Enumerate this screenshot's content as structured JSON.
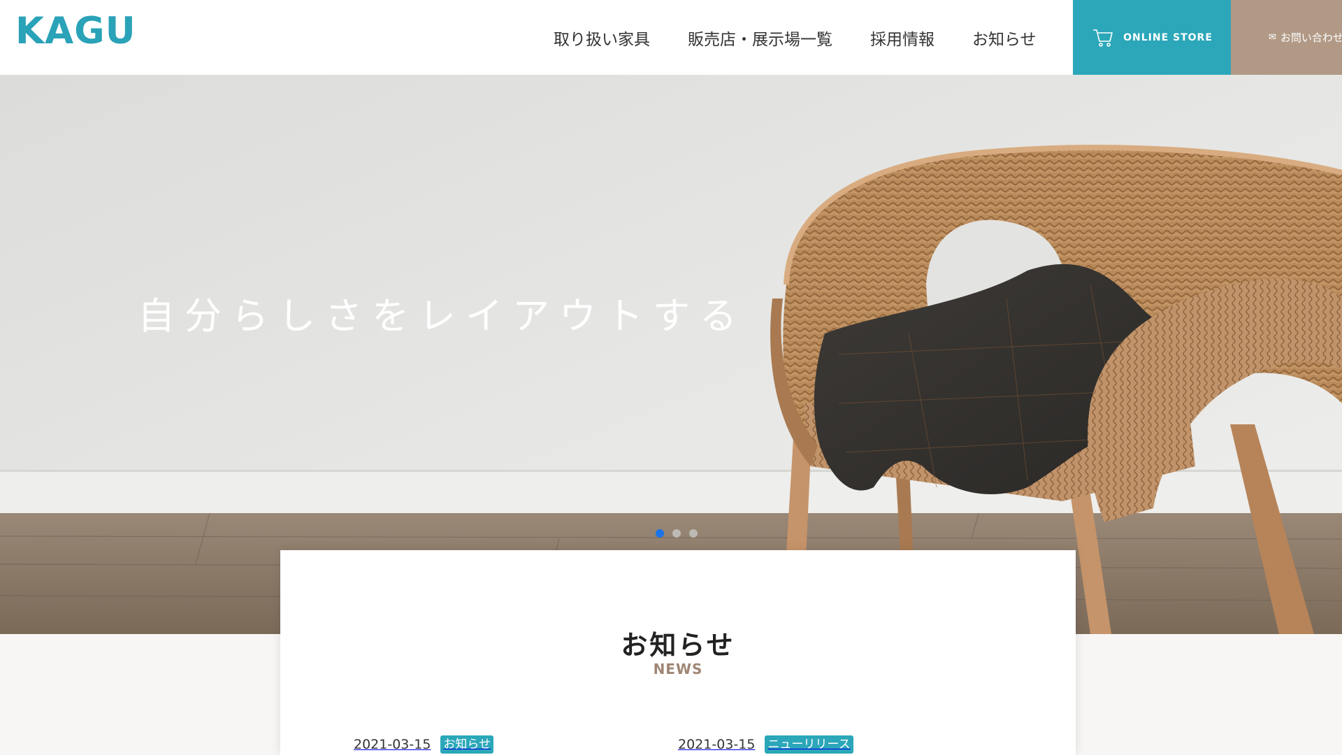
{
  "header": {
    "logo": "KAGU",
    "nav": [
      {
        "label": "取り扱い家具"
      },
      {
        "label": "販売店・展示場一覧"
      },
      {
        "label": "採用情報"
      },
      {
        "label": "お知らせ"
      }
    ],
    "store_label": "ONLINE STORE",
    "contact_label": "お問い合わせ",
    "colors": {
      "accent": "#2ba7b9",
      "brown": "#b19985",
      "logo": "#2aa2b8"
    }
  },
  "hero": {
    "catchphrase": "自分らしさをレイアウトする",
    "slides_total": 3,
    "active_slide": 1
  },
  "news": {
    "title": "お知らせ",
    "subtitle": "NEWS",
    "items": [
      {
        "date": "2021-03-15",
        "tag": "お知らせ"
      },
      {
        "date": "2021-03-15",
        "tag": "ニューリリース"
      }
    ]
  }
}
